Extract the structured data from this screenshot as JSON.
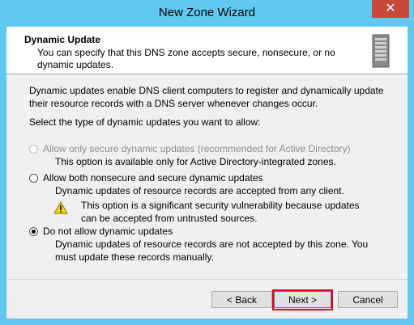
{
  "window": {
    "title": "New Zone Wizard",
    "close_label": "✕"
  },
  "header": {
    "title": "Dynamic Update",
    "subtitle": "You can specify that this DNS zone accepts secure, nonsecure, or no dynamic updates.",
    "icon": "server-icon"
  },
  "body": {
    "intro": "Dynamic updates enable DNS client computers to register and dynamically update their resource records with a DNS server whenever changes occur.",
    "prompt": "Select the type of dynamic updates you want to allow:"
  },
  "options": [
    {
      "label": "Allow only secure dynamic updates (recommended for Active Directory)",
      "description": "This option is available only for Active Directory-integrated zones.",
      "enabled": false,
      "selected": false
    },
    {
      "label": "Allow both nonsecure and secure dynamic updates",
      "description": "Dynamic updates of resource records are accepted from any client.",
      "warning": "This option is a significant security vulnerability because updates can be accepted from untrusted sources.",
      "enabled": true,
      "selected": false
    },
    {
      "label": "Do not allow dynamic updates",
      "description": "Dynamic updates of resource records are not accepted by this zone. You must update these records manually.",
      "enabled": true,
      "selected": true
    }
  ],
  "buttons": {
    "back": "< Back",
    "next": "Next >",
    "cancel": "Cancel"
  },
  "colors": {
    "titlebar": "#5fc9f1",
    "close": "#c7493a",
    "highlight": "#e3001b"
  }
}
